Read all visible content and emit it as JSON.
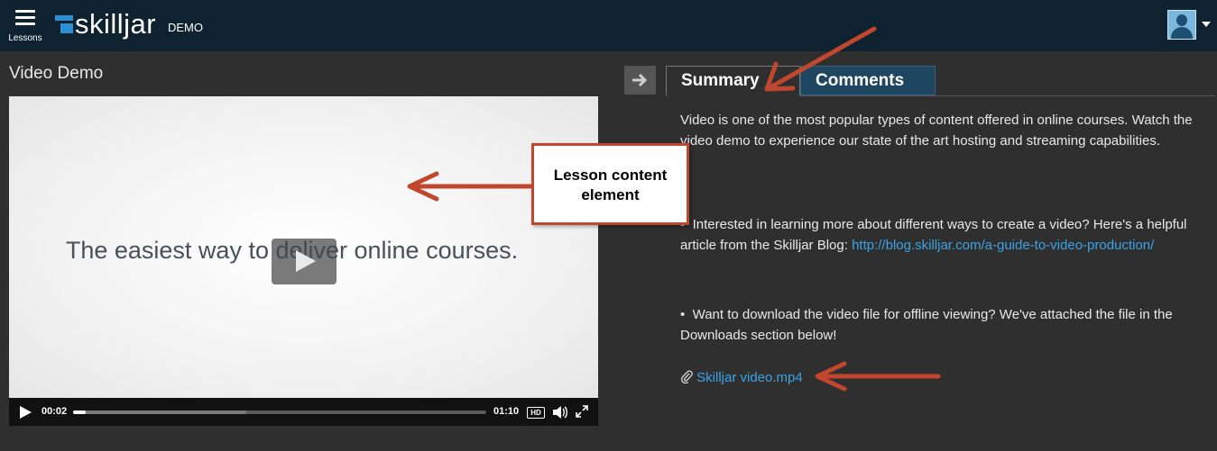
{
  "header": {
    "menu_label": "Lessons",
    "brand": "skilljar",
    "brand_sub": "DEMO"
  },
  "lesson": {
    "title": "Video Demo"
  },
  "video": {
    "caption": "The easiest way to deliver online courses.",
    "current_time": "00:02",
    "duration": "01:10",
    "hd_label": "HD",
    "progress": 0.03,
    "buffered": 0.42
  },
  "tabs": [
    {
      "label": "Summary",
      "active": true
    },
    {
      "label": "Comments",
      "active": false
    }
  ],
  "summary": {
    "intro": "Video is one of the most popular types of content offered in online courses. Watch the video demo to experience our state of the art hosting and streaming capabilities.",
    "bullet1_text": "Interested in learning more about different ways to create a video? Here's a helpful article from the Skilljar Blog: ",
    "bullet1_link": "http://blog.skilljar.com/a-guide-to-video-production/",
    "bullet2_text": "Want to download the video file for offline viewing? We've attached the file in the Downloads section below!",
    "bullet_glyph": "•",
    "download_file": "Skilljar video.mp4"
  },
  "annotation": {
    "callout": "Lesson content element",
    "color": "#c0462d"
  },
  "colors": {
    "topbar": "#0e2230",
    "page_bg": "#2f2f2f",
    "link": "#3aa3e6",
    "brand_blue": "#2b8fd6",
    "comments_tab": "#1f4660"
  },
  "icons": [
    "menu-icon",
    "user-avatar-icon",
    "caret-down-icon",
    "arrow-right-icon",
    "play-icon",
    "volume-icon",
    "fullscreen-icon",
    "paperclip-icon"
  ]
}
